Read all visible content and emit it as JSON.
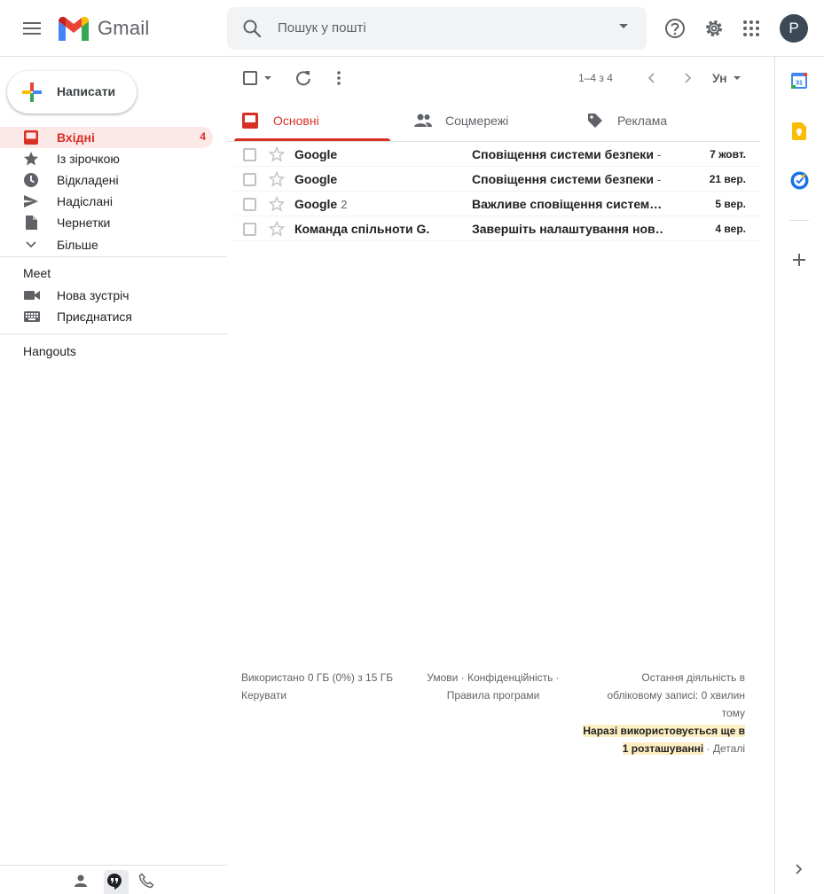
{
  "header": {
    "app_name": "Gmail",
    "search_placeholder": "Пошук у пошті",
    "avatar_letter": "P"
  },
  "sidebar": {
    "compose_label": "Написати",
    "items": [
      {
        "label": "Вхідні",
        "count": "4",
        "icon": "inbox-icon"
      },
      {
        "label": "Із зірочкою",
        "icon": "star-icon"
      },
      {
        "label": "Відкладені",
        "icon": "clock-icon"
      },
      {
        "label": "Надіслані",
        "icon": "send-icon"
      },
      {
        "label": "Чернетки",
        "icon": "draft-icon"
      },
      {
        "label": "Більше",
        "icon": "chevron-down-icon"
      }
    ],
    "meet": {
      "title": "Meet",
      "items": [
        {
          "label": "Нова зустріч",
          "icon": "video-icon"
        },
        {
          "label": "Приєднатися",
          "icon": "keyboard-icon"
        }
      ]
    },
    "hangouts_title": "Hangouts"
  },
  "toolbar": {
    "page_info": "1–4 з 4",
    "lang_label": "Ун"
  },
  "tabs": [
    {
      "label": "Основні",
      "icon": "inbox-icon",
      "active": true
    },
    {
      "label": "Соцмережі",
      "icon": "people-icon"
    },
    {
      "label": "Реклама",
      "icon": "tag-icon"
    }
  ],
  "emails": [
    {
      "sender": "Google",
      "count": "",
      "subject": "Сповіщення системи безпеки",
      "sep": " - ",
      "date": "7 жовт."
    },
    {
      "sender": "Google",
      "count": "",
      "subject": "Сповіщення системи безпеки",
      "sep": " - ",
      "date": "21 вер."
    },
    {
      "sender": "Google",
      "count": "2",
      "subject": "Важливе сповіщення систем…",
      "sep": "",
      "date": "5 вер."
    },
    {
      "sender": "Команда спільноти G.",
      "count": "",
      "subject": "Завершіть налаштування нов…",
      "sep": "",
      "date": "4 вер."
    }
  ],
  "footer": {
    "storage": "Використано 0 ГБ (0%) з 15 ГБ",
    "manage": "Керувати",
    "terms": "Умови · Конфіденційність ·",
    "policies": "Правила програми",
    "activity_line1": "Остання діяльність в",
    "activity_line2": "обліковому записі: 0 хвилин",
    "activity_line3": "тому",
    "open_line1": "Наразі використовується ще в",
    "open_line2": "1 розташуванні",
    "details": " · Деталі"
  },
  "colors": {
    "accent_red": "#d93025",
    "inbox_highlight": "#fce8e6",
    "calendar_blue": "#4285f4",
    "keep_yellow": "#fbbc04",
    "tasks_blue": "#1a73e8"
  }
}
